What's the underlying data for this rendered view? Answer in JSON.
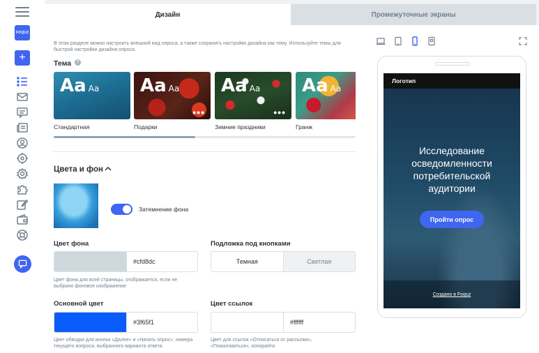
{
  "sidebar": {
    "logo_text": "FOQUZ",
    "add_label": "+",
    "icons": [
      "list-icon",
      "mail-icon",
      "message-icon",
      "news-icon",
      "user-circle-icon",
      "target-icon",
      "gear-icon",
      "puzzle-icon",
      "edit-icon",
      "wallet-icon",
      "lifebuoy-icon"
    ]
  },
  "tabs": {
    "design": "Дизайн",
    "screens": "Промежуточные экраны"
  },
  "intro": "В этом разделе можно настроить внешний вид опроса, а также сохранить настройки дизайна как тему. Используйте темы для быстрой настройки дизайна опроса.",
  "theme": {
    "title": "Тема",
    "help": "?",
    "items": [
      {
        "name": "Стандартная",
        "aa": "Aa",
        "aa_small": "Aa",
        "dots": ""
      },
      {
        "name": "Подарки",
        "aa": "Aa",
        "aa_small": "Aa",
        "dots": "•••"
      },
      {
        "name": "Зимние праздники",
        "aa": "Aa",
        "aa_small": "Aa",
        "dots": "•••"
      },
      {
        "name": "Гранж",
        "aa": "Aa",
        "aa_small": "Aa",
        "dots": ""
      }
    ]
  },
  "colors": {
    "title": "Цвета и фон",
    "dim_label": "Затемнение фона",
    "dim_enabled": true,
    "bg": {
      "label": "Цвет фона",
      "value": "#cfd8dc",
      "hint": "Цвет фона для всей страницы, отображается, если не выбрано фоновое изображение"
    },
    "button_bg": {
      "label": "Подложка под кнопками",
      "options": [
        "Темная",
        "Светлая"
      ],
      "selected": "Темная"
    },
    "main": {
      "label": "Основной цвет",
      "value": "#3f65f1",
      "hint": "Цвет обводки для кнопки «Далее» и «Начать опрос», номера текущего вопроса, выбранного варианта ответа"
    },
    "link": {
      "label": "Цвет ссылок",
      "value": "#ffffff",
      "hint": "Цвет для ссылок «Отписаться от рассылки», «Пожаловаться», копирайта"
    }
  },
  "preview": {
    "devices": [
      "laptop-icon",
      "tablet-icon",
      "phone-icon",
      "app-icon"
    ],
    "expand": "expand-icon",
    "logo": "Логотип",
    "title": "Исследование осведомленности потребительской аудитории",
    "start_button": "Пройти опрос",
    "made_in": "Создано в Foquz"
  },
  "accent": "#3f65f1"
}
